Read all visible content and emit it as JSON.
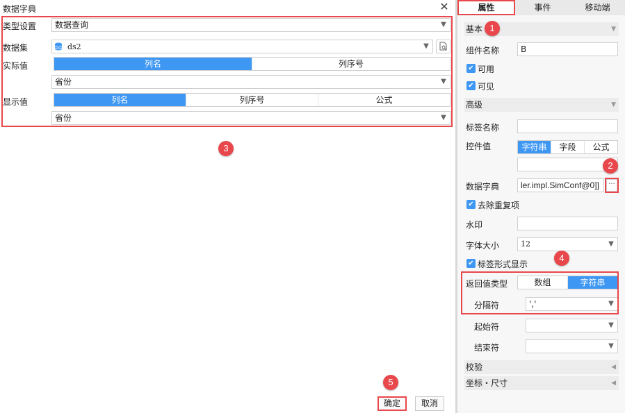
{
  "dialog": {
    "title": "数据字典",
    "close_glyph": "✕",
    "type_label": "类型设置",
    "type_value": "数据查询",
    "dataset_label": "数据集",
    "dataset_value": "ds2",
    "actual_label": "实际值",
    "actual_tabs": [
      "列名",
      "列序号"
    ],
    "actual_field": "省份",
    "display_label": "显示值",
    "display_tabs": [
      "列名",
      "列序号",
      "公式"
    ],
    "display_field": "省份",
    "confirm": "确定",
    "cancel": "取消"
  },
  "badges": [
    "1",
    "2",
    "3",
    "4",
    "5"
  ],
  "panel": {
    "tabs": [
      "属性",
      "事件",
      "移动端"
    ],
    "basic": "基本",
    "component_name_label": "组件名称",
    "component_name_value": "B",
    "enabled": "可用",
    "visible": "可见",
    "advanced": "高级",
    "tag_name_label": "标签名称",
    "control_value_label": "控件值",
    "control_value_tabs": [
      "字符串",
      "字段",
      "公式"
    ],
    "data_dict_label": "数据字典",
    "data_dict_value": "ler.impl.SimConf@0]]",
    "dots": "···",
    "dedupe": "去除重复项",
    "watermark_label": "水印",
    "font_size_label": "字体大小",
    "font_size_value": "12",
    "tag_display": "标签形式显示",
    "return_type_label": "返回值类型",
    "return_type_tabs": [
      "数组",
      "字符串"
    ],
    "separator_label": "分隔符",
    "separator_value": "','",
    "start_label": "起始符",
    "end_label": "结束符",
    "validation": "校验",
    "coords": "坐标・尺寸"
  },
  "colors": {
    "accent": "#3d97f3",
    "highlight": "#e8474b"
  }
}
